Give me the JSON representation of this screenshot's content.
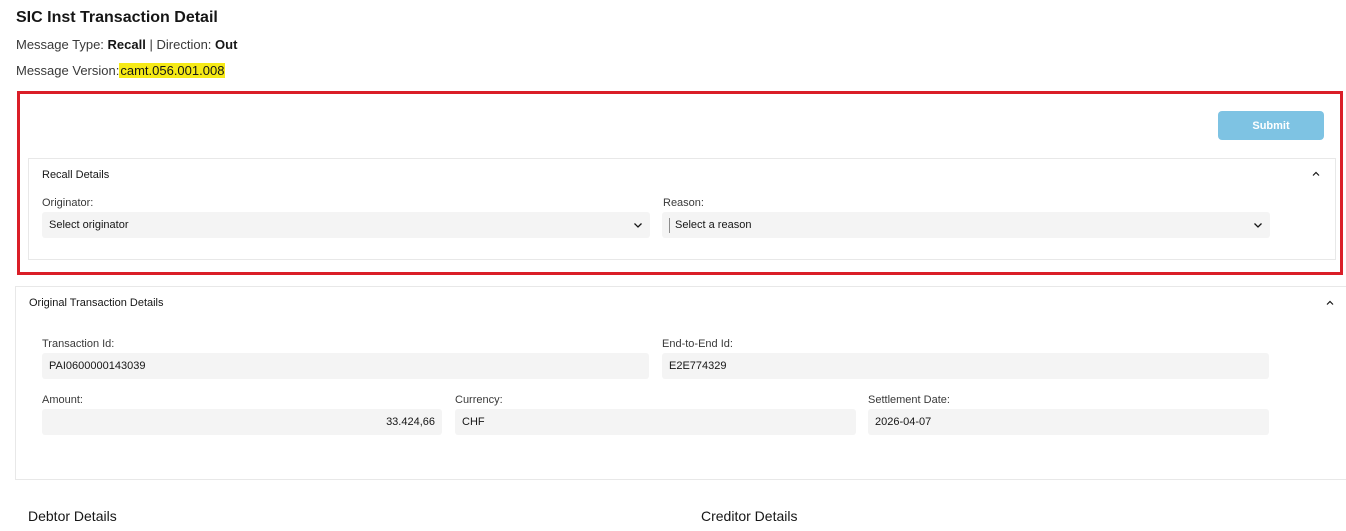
{
  "header": {
    "title": "SIC Inst Transaction Detail",
    "message_type_label": "Message Type:",
    "message_type_value": "Recall",
    "separator": "|",
    "direction_label": "Direction:",
    "direction_value": "Out",
    "version_label": "Message Version:",
    "version_value": "camt.056.001.008"
  },
  "actions": {
    "submit_label": "Submit"
  },
  "recall_details": {
    "title": "Recall Details",
    "originator_label": "Originator:",
    "originator_placeholder": "Select originator",
    "reason_label": "Reason:",
    "reason_placeholder": "Select a reason"
  },
  "original_transaction": {
    "title": "Original Transaction Details",
    "transaction_id_label": "Transaction Id:",
    "transaction_id_value": "PAI0600000143039",
    "end_to_end_label": "End-to-End Id:",
    "end_to_end_value": "E2E774329",
    "amount_label": "Amount:",
    "amount_value": "33.424,66",
    "currency_label": "Currency:",
    "currency_value": "CHF",
    "settlement_label": "Settlement Date:",
    "settlement_value": "2026-04-07"
  },
  "sections": {
    "debtor_title": "Debtor Details",
    "creditor_title": "Creditor Details"
  },
  "colors": {
    "highlight": "#f6ea16",
    "frame_red": "#da1e28",
    "submit_bg": "#7ec3e3",
    "field_bg": "#f4f4f4"
  },
  "icons": {
    "collapse": "chevron-up-icon",
    "dropdown": "chevron-down-icon"
  }
}
